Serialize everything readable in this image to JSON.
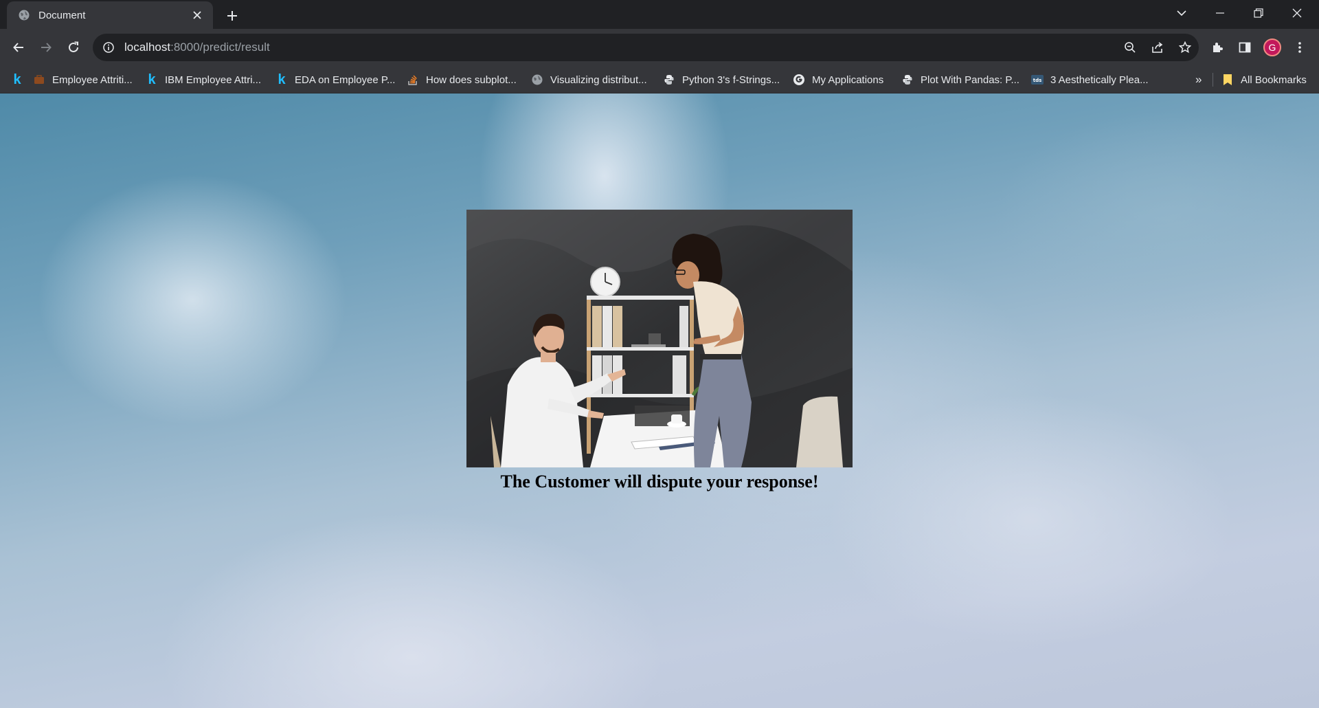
{
  "browser": {
    "tab": {
      "title": "Document"
    },
    "address": {
      "host": "localhost",
      "rest": ":8000/predict/result"
    },
    "profile_initial": "G",
    "bookmarks": [
      {
        "label": "Employee Attriti...",
        "icon": "kaggle-briefcase-icon"
      },
      {
        "label": "IBM Employee Attri...",
        "icon": "kaggle-icon"
      },
      {
        "label": "EDA on Employee P...",
        "icon": "kaggle-icon"
      },
      {
        "label": "How does subplot...",
        "icon": "stackoverflow-icon"
      },
      {
        "label": "Visualizing distribut...",
        "icon": "globe-icon"
      },
      {
        "label": "Python 3's f-Strings...",
        "icon": "python-icon"
      },
      {
        "label": "My Applications",
        "icon": "google-icon"
      },
      {
        "label": "Plot With Pandas: P...",
        "icon": "python-icon"
      },
      {
        "label": "3 Aesthetically Plea...",
        "icon": "tds-icon"
      }
    ],
    "bookmarks_overflow": "»",
    "all_bookmarks": "All Bookmarks",
    "colors": {
      "frame": "#202124",
      "toolbar": "#35363a",
      "text": "#e8eaed",
      "avatar": "#c2185b"
    }
  },
  "page": {
    "result_message": "The Customer will dispute your response!"
  }
}
